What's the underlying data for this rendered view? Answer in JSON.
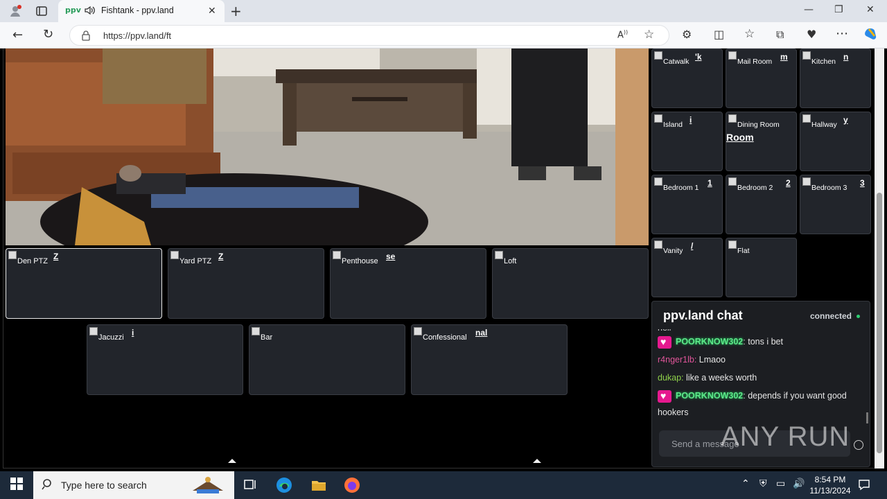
{
  "browser": {
    "tab_title": "Fishtank - ppv.land",
    "tab_favicon": "ppv",
    "url": "https://ppv.land/ft"
  },
  "main_cams": [
    {
      "label": "Den PTZ",
      "glyph": "Z",
      "active": true
    },
    {
      "label": "Yard PTZ",
      "glyph": "Z",
      "active": false
    },
    {
      "label": "Penthouse",
      "glyph": "se",
      "active": false
    },
    {
      "label": "Loft",
      "glyph": "",
      "active": false
    },
    {
      "label": "Jacuzzi",
      "glyph": "i",
      "active": false
    },
    {
      "label": "Bar",
      "glyph": "",
      "active": false
    },
    {
      "label": "Confessional",
      "glyph": "nal",
      "active": false
    }
  ],
  "side_cams": [
    {
      "label": "Catwalk",
      "glyph": "'k"
    },
    {
      "label": "Mail Room",
      "glyph": "m"
    },
    {
      "label": "Kitchen",
      "glyph": "n"
    },
    {
      "label": "Island",
      "glyph": "i"
    },
    {
      "label": "Dining Room",
      "glyph": "Room"
    },
    {
      "label": "Hallway",
      "glyph": "y"
    },
    {
      "label": "Bedroom 1",
      "glyph": "1"
    },
    {
      "label": "Bedroom 2",
      "glyph": "2"
    },
    {
      "label": "Bedroom 3",
      "glyph": "3"
    },
    {
      "label": "Vanity",
      "glyph": "/"
    },
    {
      "label": "Flat",
      "glyph": ""
    }
  ],
  "chat": {
    "title": "ppv.land chat",
    "status": "connected",
    "status_color": "#2ecc71",
    "partial_line": "hell",
    "messages": [
      {
        "user": "POORKNOW302",
        "text": "tons i bet",
        "badge": true,
        "user_color": "#5ee88a"
      },
      {
        "user": "r4nger1lb:",
        "text": "Lmaoo",
        "badge": false,
        "user_color": "#e0559a"
      },
      {
        "user": "dukap:",
        "text": "like a weeks worth",
        "badge": false,
        "user_color": "#8ed04a"
      },
      {
        "user": "POORKNOW302",
        "text": "depends if you want good hookers",
        "badge": true,
        "user_color": "#5ee88a"
      }
    ],
    "input_placeholder": "Send a message"
  },
  "watermark": "ANY RUN",
  "taskbar": {
    "search_placeholder": "Type here to search",
    "time": "8:54 PM",
    "date": "11/13/2024"
  }
}
